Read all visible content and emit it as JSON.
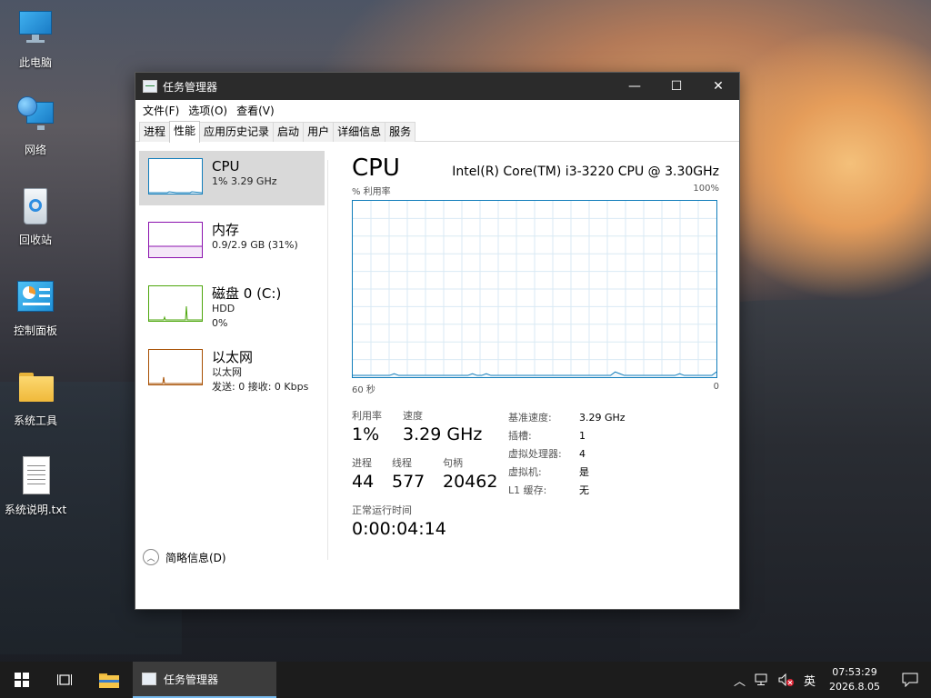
{
  "desktop": {
    "icons": [
      {
        "label": "此电脑",
        "icon": "computer-icon"
      },
      {
        "label": "网络",
        "icon": "network-icon"
      },
      {
        "label": "回收站",
        "icon": "recycle-bin-icon"
      },
      {
        "label": "控制面板",
        "icon": "control-panel-icon"
      },
      {
        "label": "系统工具",
        "icon": "folder-icon"
      },
      {
        "label": "系统说明.txt",
        "icon": "text-file-icon"
      }
    ]
  },
  "window": {
    "title": "任务管理器",
    "controls": {
      "minimize": "—",
      "maximize": "☐",
      "close": "✕"
    },
    "menu": [
      "文件(F)",
      "选项(O)",
      "查看(V)"
    ],
    "tabs": [
      "进程",
      "性能",
      "应用历史记录",
      "启动",
      "用户",
      "详细信息",
      "服务"
    ],
    "active_tab": "性能"
  },
  "sidebar": {
    "items": [
      {
        "name": "CPU",
        "line1": "1% 3.29 GHz",
        "line2": "",
        "color": "#117dbb"
      },
      {
        "name": "内存",
        "line1": "0.9/2.9 GB (31%)",
        "line2": "",
        "color": "#8b12ae"
      },
      {
        "name": "磁盘 0 (C:)",
        "line1": "HDD",
        "line2": "0%",
        "color": "#4da60c"
      },
      {
        "name": "以太网",
        "line1": "以太网",
        "line2": "发送: 0 接收: 0 Kbps",
        "color": "#a74f01"
      }
    ]
  },
  "detail": {
    "title": "CPU",
    "model": "Intel(R) Core(TM) i3-3220 CPU @ 3.30GHz",
    "graph_top_left": "% 利用率",
    "graph_top_right": "100%",
    "graph_bottom_left": "60 秒",
    "graph_bottom_right": "0",
    "stats": {
      "util_label": "利用率",
      "util_value": "1%",
      "speed_label": "速度",
      "speed_value": "3.29 GHz",
      "proc_label": "进程",
      "proc_value": "44",
      "thread_label": "线程",
      "thread_value": "577",
      "handle_label": "句柄",
      "handle_value": "20462",
      "uptime_label": "正常运行时间",
      "uptime_value": "0:00:04:14"
    },
    "specs": [
      {
        "k": "基准速度:",
        "v": "3.29 GHz"
      },
      {
        "k": "插槽:",
        "v": "1"
      },
      {
        "k": "虚拟处理器:",
        "v": "4"
      },
      {
        "k": "虚拟机:",
        "v": "是"
      },
      {
        "k": "L1 缓存:",
        "v": "无"
      }
    ]
  },
  "bottom": {
    "label": "简略信息(D)"
  },
  "taskbar": {
    "app_label": "任务管理器",
    "ime": "英",
    "time": "07:53:29",
    "date": "2026.8.05"
  },
  "chart_data": {
    "type": "line",
    "title": "CPU",
    "ylabel": "% 利用率",
    "xlabel": "60 秒",
    "ylim": [
      0,
      100
    ],
    "series": [
      {
        "values": [
          1,
          1,
          1,
          1,
          1,
          1,
          1,
          1,
          1,
          2,
          1,
          1,
          1,
          1,
          1,
          1,
          1,
          1,
          1,
          1,
          1,
          1,
          1,
          1,
          1,
          1,
          2,
          1,
          1,
          2,
          1,
          1,
          1,
          1,
          1,
          1,
          1,
          1,
          1,
          1,
          1,
          1,
          1,
          1,
          1,
          1,
          1,
          1,
          1,
          1,
          1,
          1,
          1,
          1,
          1,
          1,
          1,
          3,
          2,
          1,
          1,
          1,
          1,
          1,
          1,
          1,
          1,
          1,
          1,
          1,
          1,
          2,
          1,
          1,
          1,
          1,
          1,
          1,
          1,
          3
        ]
      }
    ]
  }
}
